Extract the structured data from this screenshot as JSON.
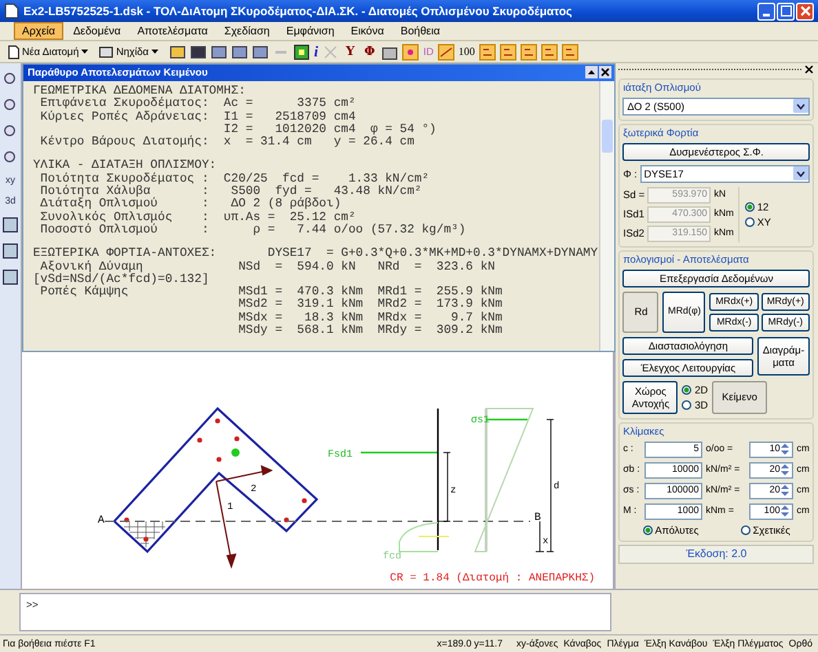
{
  "window": {
    "title": "Ex2-LB5752525-1.dsk - ΤΟΛ-ΔιΑτομη ΣΚυροδέματος-ΔΙΑ.ΣΚ. - Διατομές Οπλισμένου Σκυροδέματος"
  },
  "menu": [
    {
      "label": "Αρχεία",
      "selected": true
    },
    {
      "label": "Δεδομένα",
      "selected": false
    },
    {
      "label": "Αποτελέσματα",
      "selected": false
    },
    {
      "label": "Σχεδίαση",
      "selected": false
    },
    {
      "label": "Εμφάνιση",
      "selected": false
    },
    {
      "label": "Εικόνα",
      "selected": false
    },
    {
      "label": "Βοήθεια",
      "selected": false
    }
  ],
  "toolbar": {
    "new_section": "Νέα Διατομή",
    "layer": "Νηχίδα",
    "info": "i",
    "letters": [
      "Υ",
      "Φ"
    ],
    "id_text": "ID",
    "zoom_value": "100"
  },
  "left_toolbar": {
    "labels": [
      "xy",
      "3d"
    ]
  },
  "text_window": {
    "title": "Παράθυρο Αποτελεσμάτων Κειμένου",
    "sections": [
      {
        "lines": [
          "ΓΕΩΜΕΤΡΙΚΑ ΔΕΔΟΜΕΝΑ ΔΙΑΤΟΜΗΣ:",
          " Επιφάνεια Σκυροδέματος:  Ac =      3375 cm²",
          " Κύριες Ροπές Αδράνειας:  I1 =   2518709 cm4",
          "                          I2 =   1012020 cm4  φ = 54 °)",
          " Κέντρο Βάρους Διατομής:  x  = 31.4 cm   y = 26.4 cm"
        ]
      },
      {
        "lines": [
          "ΥΛΙΚΑ - ΔΙΑΤΑΞΗ ΟΠΛΙΣΜΟΥ:",
          " Ποιότητα Σκυροδέματος :  C20/25  fcd =    1.33 kN/cm²",
          " Ποιότητα Χάλυβα       :   S500  fyd =   43.48 kN/cm²",
          " Διάταξη Οπλισμού      :   ΔΟ 2 (8 ράβδοι)",
          " Συνολικός Οπλισμός    :  υπ.As =  25.12 cm²",
          " Ποσοστό Οπλισμού      :      ρ =   7.44 ο/οο (57.32 kg/m³)"
        ]
      },
      {
        "lines": [
          "ΕΞΩΤΕΡΙΚΑ ΦΟΡΤΙΑ-ΑΝΤΟΧΕΣ:       DYSE17  = G+0.3*Q+0.3*MK+MD+0.3*DYNAMX+DYNAMY",
          " Αξονική Δύναμη             NSd  =  594.0 kN   NRd  =  323.6 kN",
          "[vSd=NSd/(Ac*fcd)=0.132]",
          " Ροπές Κάμψης               MSd1 =  470.3 kNm  MRd1 =  255.9 kNm",
          "                            MSd2 =  319.1 kNm  MRd2 =  173.9 kNm",
          "                            MSdx =   18.3 kNm  MRdx =    9.7 kNm",
          "                            MSdy =  568.1 kNm  MRdy =  309.2 kNm"
        ]
      }
    ]
  },
  "canvas": {
    "point_a": "A",
    "point_b": "B",
    "axis_labels": [
      "2",
      "1"
    ],
    "force_label": "Fsd1",
    "steel_stress_label": "σs1",
    "concrete_stress_label": "fcd",
    "lever_label": "z",
    "depth_label": "d",
    "neutral_depth_label": "x",
    "result": "CR = 1.84 (Διατομή : ΑΝΕΠΑΡΚΗΣ)"
  },
  "side_panel": {
    "reinforcement": {
      "title": "ιάταξη Οπλισμού",
      "value": "ΔΟ 2 (S500)"
    },
    "loads": {
      "title": "ξωτερικά Φορτία",
      "worst_button": "Δυσμενέστερος Σ.Φ.",
      "combo_label": "Φ :",
      "combo_value": "DYSE17",
      "fields": [
        {
          "label": "Sd =",
          "value": "593.970",
          "unit": "kN",
          "disabled": true
        },
        {
          "label": "ISd1",
          "value": "470.300",
          "unit": "kNm",
          "disabled": true
        },
        {
          "label": "ISd2",
          "value": "319.150",
          "unit": "kNm",
          "disabled": true
        }
      ],
      "axes": [
        {
          "label": "12",
          "selected": true
        },
        {
          "label": "XY",
          "selected": false
        }
      ]
    },
    "calculations": {
      "title": "πολογισμοί - Αποτελέσματα",
      "process_button": "Επεξεργασία Δεδομένων",
      "big_buttons": [
        "Rd",
        "MRd(φ)"
      ],
      "small_buttons": [
        "MRdx(+)",
        "MRdy(+)",
        "MRdx(-)",
        "MRdy(-)"
      ],
      "design_button": "Διαστασιολόγηση",
      "check_button": "Έλεγχος Λειτουργίας",
      "diagrams_button": "Διαγράμ-ματα",
      "space_button": "Χώρος Αντοχής",
      "dims": [
        {
          "label": "2D",
          "selected": true
        },
        {
          "label": "3D",
          "selected": false
        }
      ],
      "text_button": "Κείμενο"
    },
    "scales": {
      "title": "Κλίμακες",
      "rows": [
        {
          "label": "c :",
          "value": "5",
          "unit": "ο/οο =",
          "length": "10",
          "length_unit": "cm"
        },
        {
          "label": "σb :",
          "value": "10000",
          "unit": "kN/m² =",
          "length": "20",
          "length_unit": "cm"
        },
        {
          "label": "σs :",
          "value": "100000",
          "unit": "kN/m² =",
          "length": "20",
          "length_unit": "cm"
        },
        {
          "label": "M :",
          "value": "1000",
          "unit": "kNm =",
          "length": "100",
          "length_unit": "cm"
        }
      ],
      "modes": [
        {
          "label": "Απόλυτες",
          "selected": true
        },
        {
          "label": "Σχετικές",
          "selected": false
        }
      ]
    },
    "version": "Έκδοση: 2.0"
  },
  "command": {
    "prompt": ">>"
  },
  "status_bar": {
    "help": "Για βοήθεια πιέστε F1",
    "coords": "x=189.0 y=11.7",
    "toggles": [
      "xy-άξονες",
      "Κάναβος",
      "Πλέγμα",
      "Έλξη Κανάβου",
      "Έλξη Πλέγματος",
      "Ορθό"
    ]
  }
}
